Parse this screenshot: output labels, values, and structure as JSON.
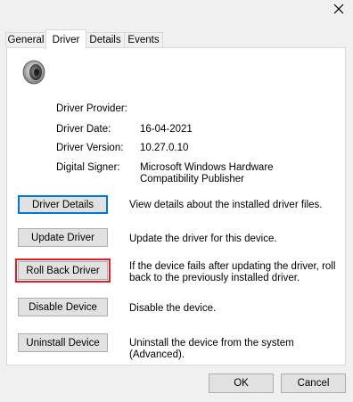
{
  "window": {
    "close_glyph": "✕"
  },
  "tabs": [
    {
      "label": "General",
      "active": false
    },
    {
      "label": "Driver",
      "active": true
    },
    {
      "label": "Details",
      "active": false
    },
    {
      "label": "Events",
      "active": false
    }
  ],
  "device_icon": "speaker-device-icon",
  "info": {
    "provider_label": "Driver Provider:",
    "provider_value": "",
    "date_label": "Driver Date:",
    "date_value": "16-04-2021",
    "version_label": "Driver Version:",
    "version_value": "10.27.0.10",
    "signer_label": "Digital Signer:",
    "signer_value": "Microsoft Windows Hardware Compatibility Publisher"
  },
  "actions": {
    "details": {
      "label": "Driver Details",
      "description": "View details about the installed driver files."
    },
    "update": {
      "label": "Update Driver",
      "description": "Update the driver for this device."
    },
    "rollback": {
      "label": "Roll Back Driver",
      "description": "If the device fails after updating the driver, roll back to the previously installed driver."
    },
    "disable": {
      "label": "Disable Device",
      "description": "Disable the device."
    },
    "uninstall": {
      "label": "Uninstall Device",
      "description": "Uninstall the device from the system (Advanced)."
    }
  },
  "footer": {
    "ok_label": "OK",
    "cancel_label": "Cancel"
  },
  "colors": {
    "focus_border": "#0078d7",
    "highlight_outline": "#e51c23"
  }
}
